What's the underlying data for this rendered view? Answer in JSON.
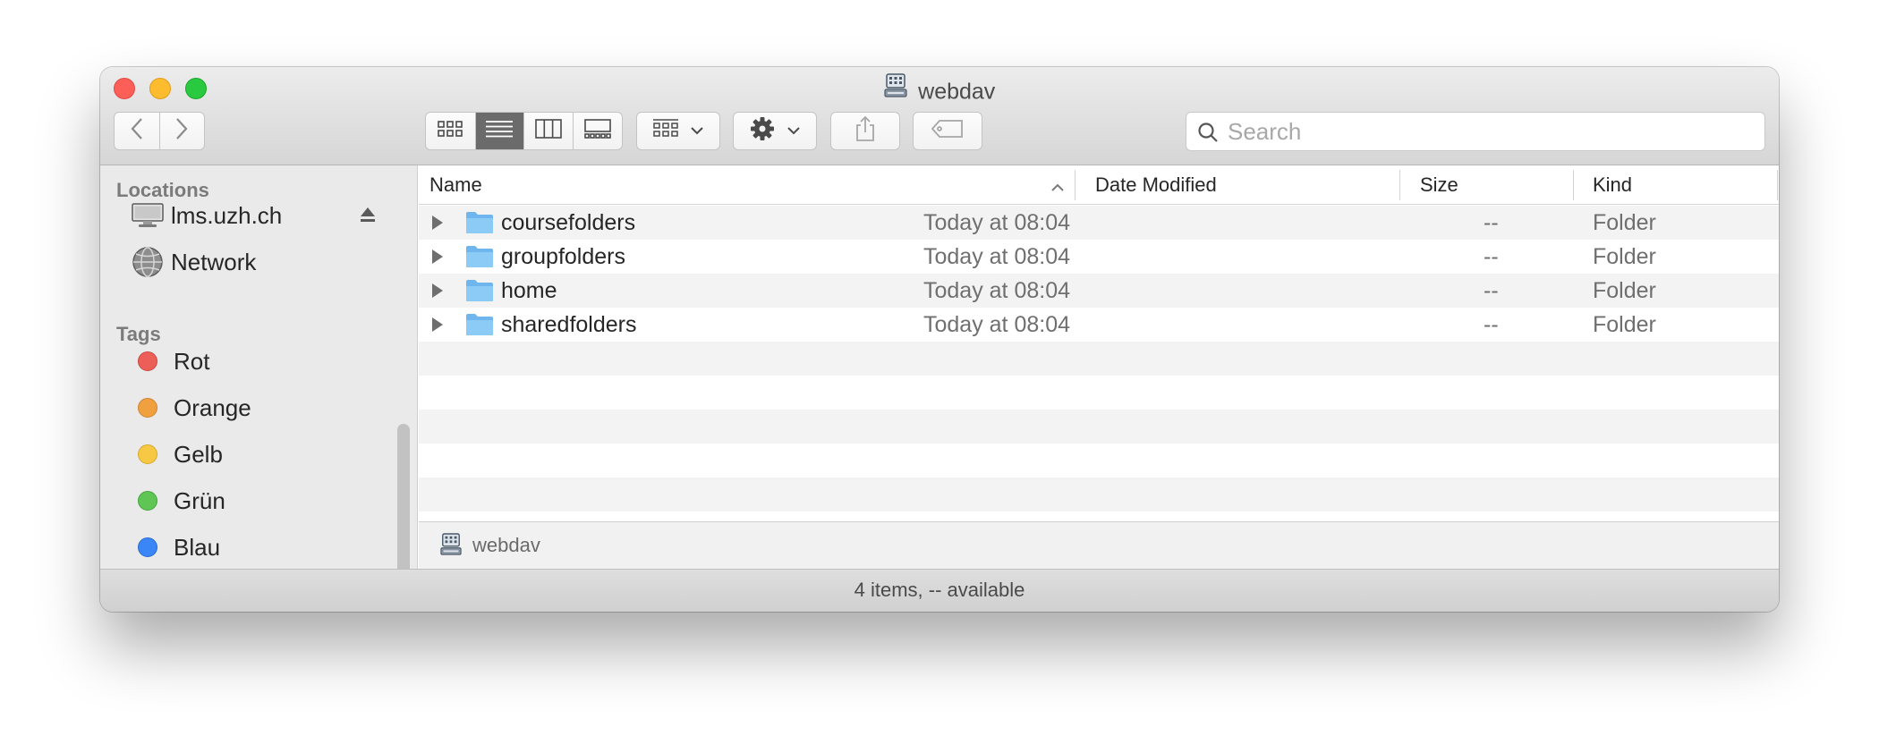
{
  "window": {
    "title": "webdav"
  },
  "toolbar": {
    "search_placeholder": "Search",
    "view_modes": [
      "icon-view",
      "list-view",
      "column-view",
      "gallery-view"
    ],
    "active_view": "list-view"
  },
  "sidebar": {
    "locations_header": "Locations",
    "locations": [
      {
        "label": "lms.uzh.ch",
        "icon": "computer-icon"
      },
      {
        "label": "Network",
        "icon": "network-icon"
      }
    ],
    "tags_header": "Tags",
    "tags": [
      {
        "label": "Rot",
        "color": "#ec5f59"
      },
      {
        "label": "Orange",
        "color": "#f0a03f"
      },
      {
        "label": "Gelb",
        "color": "#f6c844"
      },
      {
        "label": "Grün",
        "color": "#5fc655"
      },
      {
        "label": "Blau",
        "color": "#3a86f7"
      }
    ]
  },
  "columns": {
    "name": "Name",
    "date": "Date Modified",
    "size": "Size",
    "kind": "Kind"
  },
  "files": [
    {
      "name": "coursefolders",
      "date": "Today at 08:04",
      "size": "--",
      "kind": "Folder"
    },
    {
      "name": "groupfolders",
      "date": "Today at 08:04",
      "size": "--",
      "kind": "Folder"
    },
    {
      "name": "home",
      "date": "Today at 08:04",
      "size": "--",
      "kind": "Folder"
    },
    {
      "name": "sharedfolders",
      "date": "Today at 08:04",
      "size": "--",
      "kind": "Folder"
    }
  ],
  "pathbar": {
    "label": "webdav"
  },
  "status": {
    "text": "4 items, -- available"
  },
  "colors": {
    "folder": "#7cc0f3",
    "active_segment": "#6b6b6b"
  }
}
